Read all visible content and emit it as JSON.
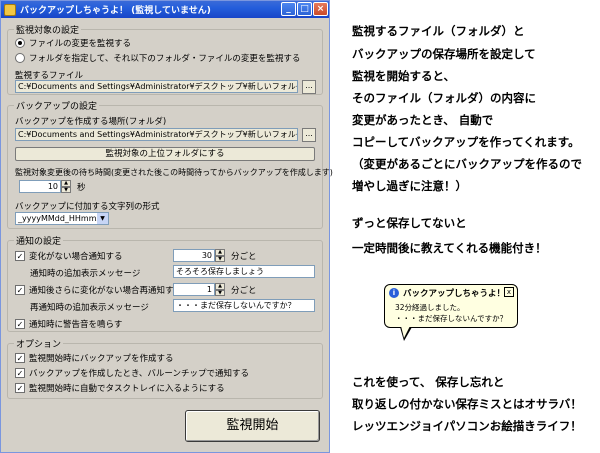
{
  "window": {
    "title": "バックアップしちゃうよ！ (監視していません)"
  },
  "target_group": {
    "label": "監視対象の設定",
    "radio_file": "ファイルの変更を監視する",
    "radio_folder": "フォルダを指定して、それ以下のフォルダ・ファイルの変更を監視する",
    "file_label": "監視するファイル",
    "file_value": "C:¥Documents and Settings¥Administrator¥デスクトップ¥新しいフォルダ (2)¥新規ビッ",
    "browse_label": "..."
  },
  "backup_group": {
    "label": "バックアップの設定",
    "dest_label": "バックアップを作成する場所(フォルダ)",
    "dest_value": "C:¥Documents and Settings¥Administrator¥デスクトップ¥新しいフォルダ (2)",
    "browse_label": "...",
    "parent_button": "監視対象の上位フォルダにする",
    "wait_label": "監視対象変更後の待ち時間(変更された後この時間待ってからバックアップを作成します)",
    "wait_value": "10",
    "wait_unit": "秒",
    "suffix_label": "バックアップに付加する文字列の形式",
    "suffix_value": "_yyyyMMdd_HHmmss"
  },
  "notify_group": {
    "label": "通知の設定",
    "no_change_label": "変化がない場合通知する",
    "no_change_value": "30",
    "no_change_unit": "分ごと",
    "extra_msg_label": "通知時の追加表示メッセージ",
    "extra_msg_value": "そろそろ保存しましょう",
    "renotify_label": "通知後さらに変化がない場合再通知する",
    "renotify_value": "1",
    "renotify_unit": "分ごと",
    "re_msg_label": "再通知時の追加表示メッセージ",
    "re_msg_value": "・・・まだ保存しないんですか？",
    "sound_label": "通知時に警告音を鳴らす"
  },
  "options_group": {
    "label": "オプション",
    "opt1": "監視開始時にバックアップを作成する",
    "opt2": "バックアップを作成したとき、バルーンチップで通知する",
    "opt3": "監視開始時に自動でタスクトレイに入るようにする"
  },
  "start_button": "監視開始",
  "notes": {
    "l1": "監視するファイル（フォルダ）と",
    "l2": "バックアップの保存場所を設定して",
    "l3": "監視を開始すると、",
    "l4": "そのファイル（フォルダ）の内容に",
    "l5": "変更があったとき、 自動で",
    "l6": "コピーしてバックアップを作ってくれます。",
    "l7": "（変更があるごとにバックアップを作るので",
    "l8": "増やし過ぎに注意！）",
    "l9": "ずっと保存してないと",
    "l10": "一定時間後に教えてくれる機能付き！",
    "l11": "これを使って、 保存し忘れと",
    "l12": "取り返しの付かない保存ミスとはオサラバ！",
    "l13": "レッツエンジョイパソコンお絵描きライフ！"
  },
  "balloon": {
    "title": "バックアップしちゃうよ！",
    "line1": "32分経過しました。",
    "line2": "・・・まだ保存しないんですか？",
    "close": "x",
    "info": "i"
  }
}
